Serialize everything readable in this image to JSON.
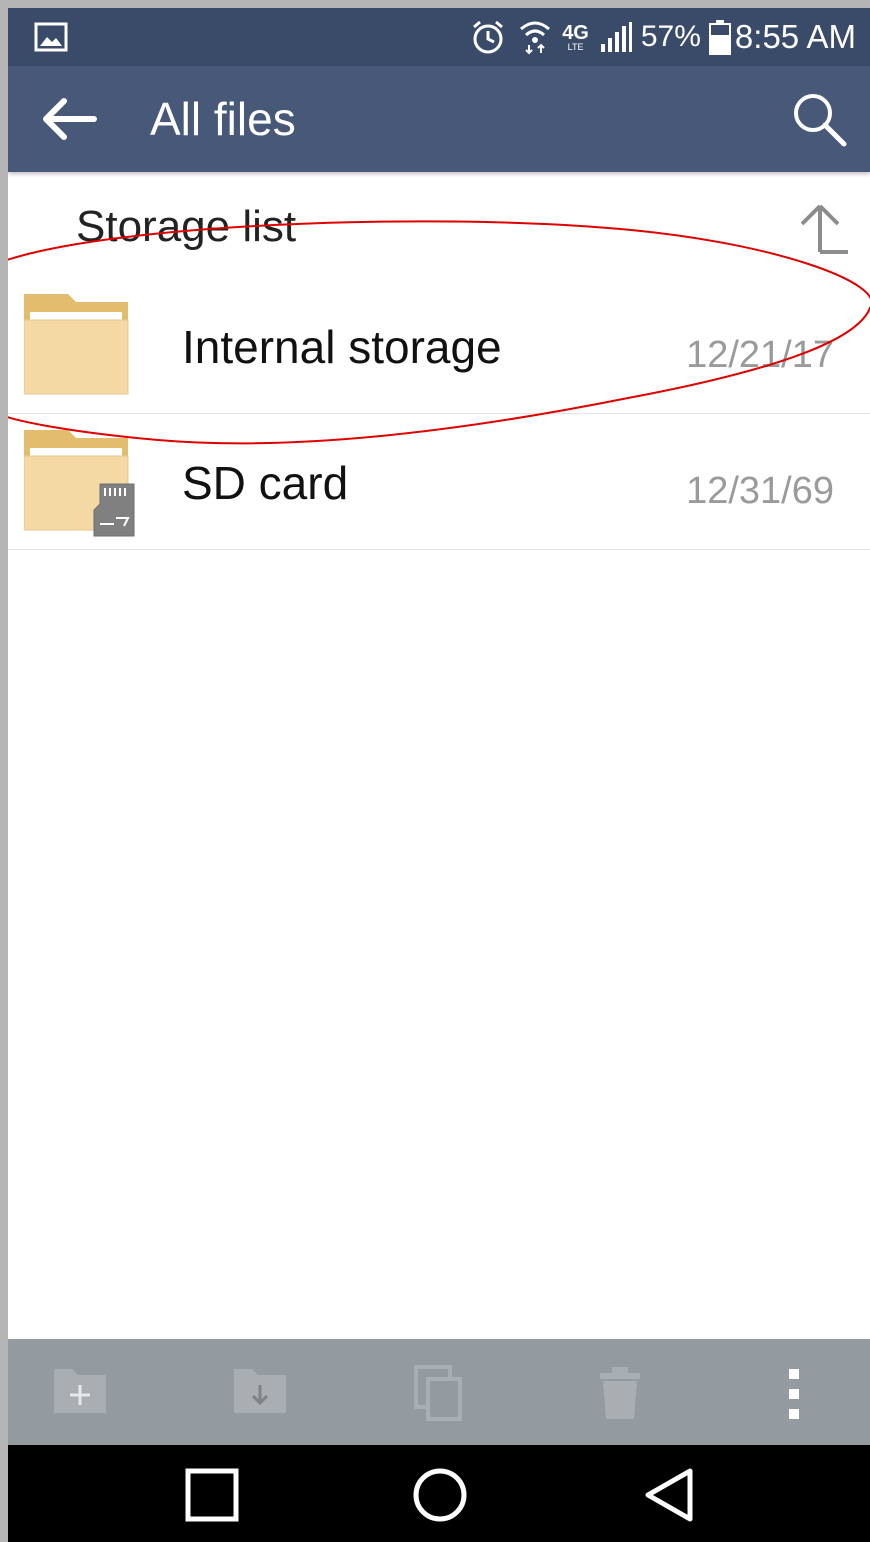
{
  "status_bar": {
    "network": "4G",
    "network_sub": "LTE",
    "battery": "57%",
    "time": "8:55 AM"
  },
  "app_bar": {
    "title": "All files"
  },
  "storage_list": {
    "header": "Storage list",
    "items": [
      {
        "name": "Internal storage",
        "date": "12/21/17",
        "icon": "folder-icon"
      },
      {
        "name": "SD card",
        "date": "12/31/69",
        "icon": "sd-card-folder-icon"
      }
    ]
  },
  "toolbar": {
    "buttons": [
      "new-folder-icon",
      "move-to-folder-icon",
      "copy-icon",
      "delete-icon",
      "more-options-icon"
    ]
  },
  "nav_bar": {
    "buttons": [
      "recents-icon",
      "home-icon",
      "back-icon"
    ]
  },
  "colors": {
    "status_bar": "#3a4a69",
    "app_bar": "#475878",
    "folder_body": "#f5d9a4",
    "folder_tab": "#e4bc6d",
    "toolbar": "#939aa0",
    "annotation": "#e00000"
  }
}
